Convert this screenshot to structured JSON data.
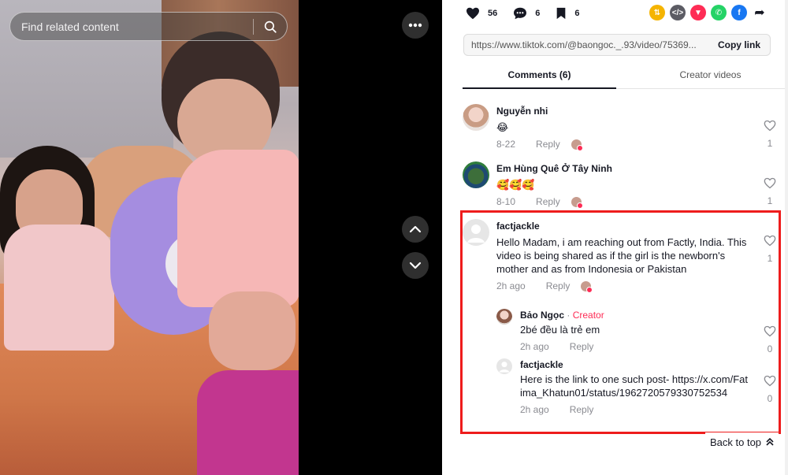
{
  "search": {
    "placeholder": "Find related content"
  },
  "stats": {
    "likes": "56",
    "comments": "6",
    "saves": "6"
  },
  "share": {
    "link": "https://www.tiktok.com/@baongoc._.93/video/75369...",
    "copy_label": "Copy link"
  },
  "tabs": [
    {
      "label": "Comments (6)",
      "active": true
    },
    {
      "label": "Creator videos",
      "active": false
    }
  ],
  "comments": [
    {
      "user": "Nguyễn nhi",
      "text": "😂",
      "date": "8-22",
      "reply": "Reply",
      "likes": "1"
    },
    {
      "user": "Em Hùng Quê Ở Tây Ninh",
      "text": "🥰🥰🥰",
      "date": "8-10",
      "reply": "Reply",
      "likes": "1"
    },
    {
      "user": "factjackle",
      "text": "Hello Madam, i am reaching out from Factly, India. This video is being shared as if the girl is the newborn's mother and as from Indonesia or Pakistan",
      "date": "2h ago",
      "reply": "Reply",
      "likes": "1",
      "replies": [
        {
          "user": "Bảo Ngọc",
          "badge": "Creator",
          "separator": " · ",
          "text": "2bé đều là trẻ em",
          "date": "2h ago",
          "reply": "Reply",
          "likes": "0"
        },
        {
          "user": "factjackle",
          "text": "Here is the link to one such post- https://x.com/Fatima_Khatun01/status/1962720579330752534",
          "date": "2h ago",
          "reply": "Reply",
          "likes": "0"
        }
      ]
    }
  ],
  "back_to_top": "Back to top",
  "colors": {
    "accent": "#fe2c55",
    "highlight": "#ee1c1c"
  }
}
